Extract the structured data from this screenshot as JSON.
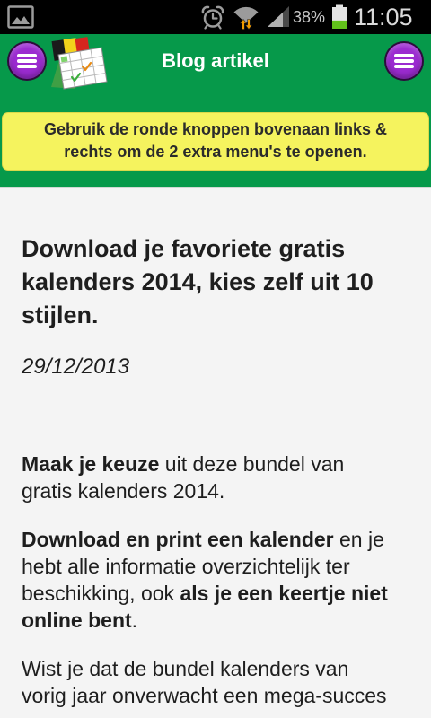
{
  "status_bar": {
    "time": "11:05",
    "battery_percent": "38%",
    "battery_level": 0.38,
    "icons": {
      "notification": "gallery-image-icon",
      "alarm": "alarm-clock-icon",
      "wifi": "wifi-icon",
      "signal": "signal-strength-icon",
      "battery": "battery-icon"
    },
    "colors": {
      "background": "#000000",
      "icon": "#9b9b9b",
      "wifi_activity": "#f29b00",
      "battery_fill": "#62c21a"
    }
  },
  "header": {
    "title": "Blog artikel",
    "app_icon": "calendar-app-icon",
    "left_button": {
      "icon": "hamburger-menu-icon"
    },
    "right_button": {
      "icon": "hamburger-menu-icon"
    },
    "colors": {
      "background": "#06994a",
      "menu_button": "#9b2bd0",
      "title": "#ffffff"
    }
  },
  "notice": {
    "lines": [
      "Gebruik de ronde knoppen bovenaan links &",
      "rechts om de 2 extra menu's te openen."
    ],
    "colors": {
      "background": "#f5f35e",
      "text": "#2b2b2b"
    }
  },
  "article": {
    "title_lines": [
      "Download je favoriete gratis",
      "kalenders 2014, kies zelf uit 10",
      "stijlen."
    ],
    "date": "29/12/2013",
    "paragraphs": [
      {
        "lines": [
          {
            "runs": [
              {
                "text": "Maak je keuze",
                "bold": true
              },
              {
                "text": " uit deze bundel van",
                "bold": false
              }
            ]
          },
          {
            "runs": [
              {
                "text": "gratis kalenders 2014.",
                "bold": false
              }
            ]
          }
        ]
      },
      {
        "lines": [
          {
            "runs": [
              {
                "text": "Download en print een kalender",
                "bold": true
              },
              {
                "text": " en je",
                "bold": false
              }
            ]
          },
          {
            "runs": [
              {
                "text": "hebt alle informatie overzichtelijk ter",
                "bold": false
              }
            ]
          },
          {
            "runs": [
              {
                "text": "beschikking, ook ",
                "bold": false
              },
              {
                "text": "als je een keertje niet",
                "bold": true
              }
            ]
          },
          {
            "runs": [
              {
                "text": "online bent",
                "bold": true
              },
              {
                "text": ".",
                "bold": false
              }
            ]
          }
        ]
      },
      {
        "lines": [
          {
            "runs": [
              {
                "text": "Wist je dat de bundel kalenders van",
                "bold": false
              }
            ]
          },
          {
            "runs": [
              {
                "text": "vorig jaar onverwacht een mega-succes",
                "bold": false
              }
            ]
          }
        ]
      }
    ],
    "colors": {
      "background": "#f4f4f4",
      "text": "#1e1e1e"
    }
  }
}
